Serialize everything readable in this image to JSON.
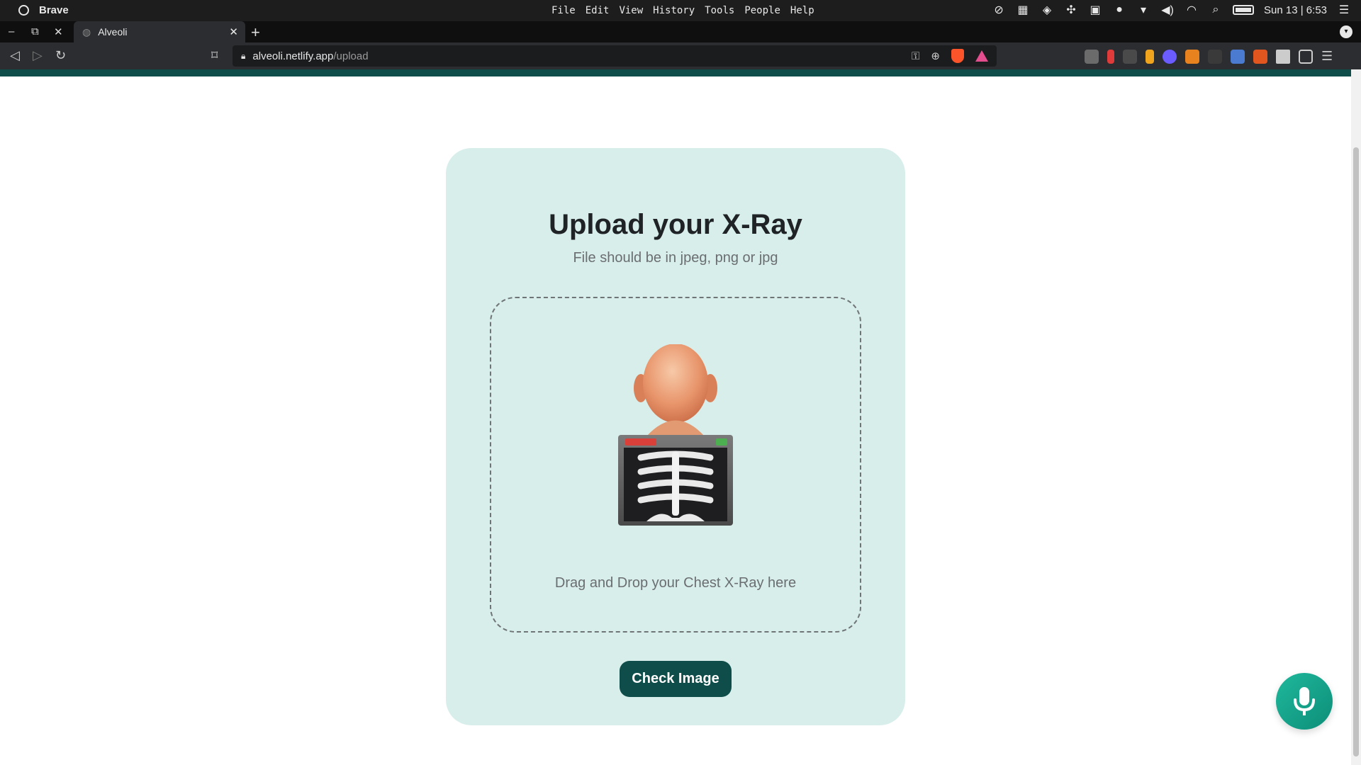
{
  "os": {
    "app_name": "Brave",
    "menu": [
      "File",
      "Edit",
      "View",
      "History",
      "Tools",
      "People",
      "Help"
    ],
    "clock": "Sun 13 | 6:53"
  },
  "browser": {
    "tab_title": "Alveoli",
    "url_host": "alveoli.netlify.app",
    "url_path": "/upload"
  },
  "upload": {
    "title": "Upload your X-Ray",
    "subtitle": "File should be in jpeg, png or jpg",
    "drop_hint": "Drag and Drop your Chest X-Ray here",
    "check_button": "Check Image"
  },
  "colors": {
    "brand_dark": "#0e4d49",
    "card_bg": "#d8eeeb",
    "mic_accent": "#1fb89c"
  },
  "icons": {
    "mic": "microphone-icon",
    "illustration": "chest-xray-illustration"
  }
}
